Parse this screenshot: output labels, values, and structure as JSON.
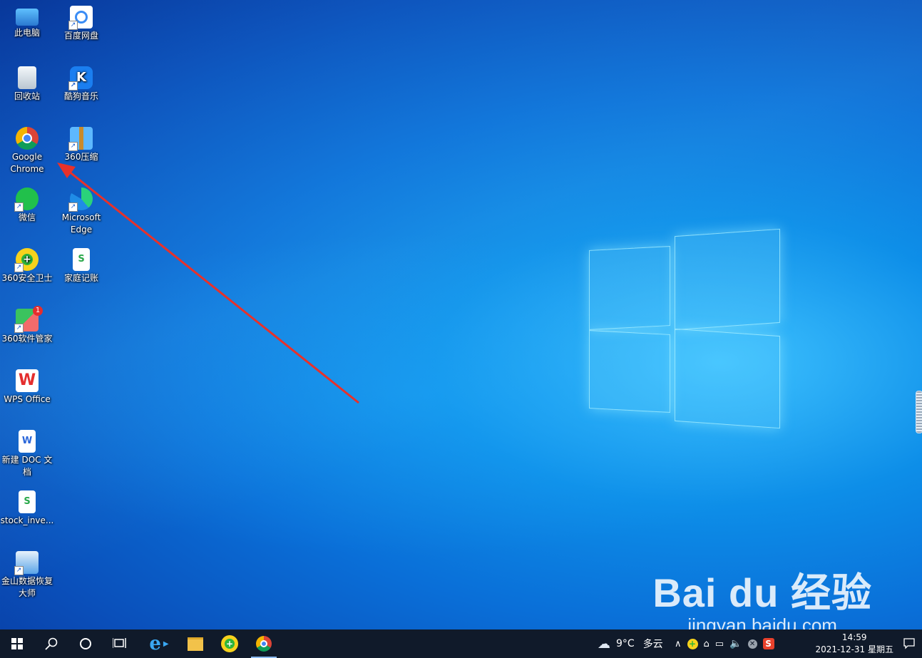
{
  "desktop_icons": [
    {
      "label": "此电脑",
      "icon": "computer-icon"
    },
    {
      "label": "百度网盘",
      "icon": "baidu-netdisk-icon"
    },
    {
      "label": "回收站",
      "icon": "recycle-bin-icon"
    },
    {
      "label": "酷狗音乐",
      "icon": "kugou-music-icon"
    },
    {
      "label": "Google Chrome",
      "icon": "chrome-icon"
    },
    {
      "label": "360压缩",
      "icon": "360-zip-icon"
    },
    {
      "label": "微信",
      "icon": "wechat-icon"
    },
    {
      "label": "Microsoft Edge",
      "icon": "edge-icon"
    },
    {
      "label": "360安全卫士",
      "icon": "360-security-icon"
    },
    {
      "label": "家庭记账",
      "icon": "spreadsheet-icon"
    },
    {
      "label": "360软件管家",
      "icon": "360-software-manager-icon"
    },
    {
      "label": "WPS Office",
      "icon": "wps-office-icon"
    },
    {
      "label": "新建 DOC 文档",
      "icon": "word-document-icon"
    },
    {
      "label": "stock_inve...",
      "icon": "spreadsheet-icon"
    },
    {
      "label": "金山数据恢复大师",
      "icon": "data-recovery-icon"
    }
  ],
  "software_manager_badge": "1",
  "watermark": {
    "main": "Bai du 经验",
    "sub": "jingyan.baidu.com"
  },
  "taskbar": {
    "weather_temp": "9°C",
    "weather_text": "多云",
    "time": "14:59",
    "date": "2021-12-31 星期五",
    "ime_label": "S"
  },
  "colors": {
    "accent": "#0a6fd8",
    "taskbar": "#101a2a",
    "annotation_arrow": "#e8312a"
  }
}
